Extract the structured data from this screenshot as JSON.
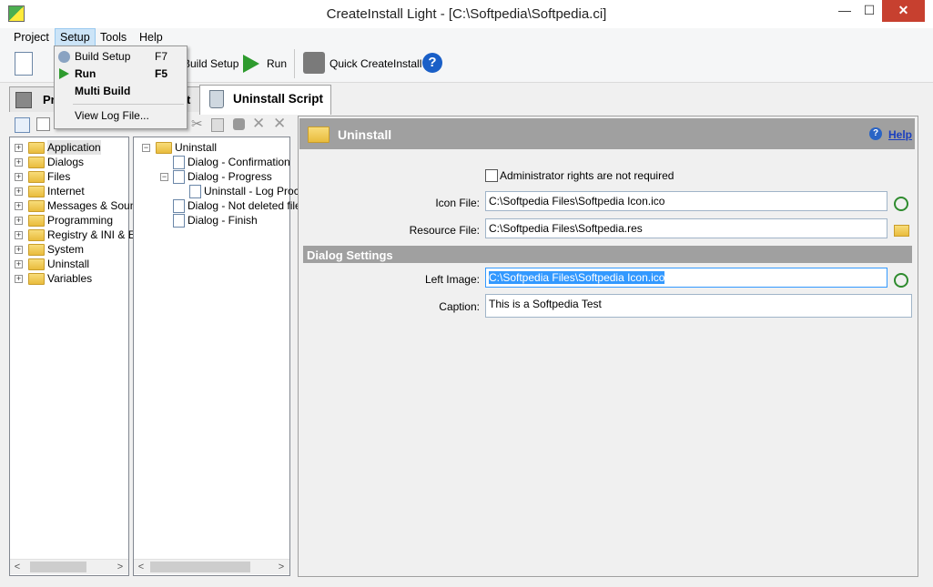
{
  "window": {
    "title": "CreateInstall Light - [C:\\Softpedia\\Softpedia.ci]",
    "min": "—",
    "max": "☐",
    "close": "✕"
  },
  "menu": [
    "Project",
    "Setup",
    "Tools",
    "Help"
  ],
  "toolbar": {
    "build_label": "Build Setup",
    "run_label": "Run",
    "quick_label": "Quick CreateInstall",
    "help_glyph": "?"
  },
  "tabs": {
    "project": "Pr",
    "script": "pt",
    "uninstall": "Uninstall Script"
  },
  "setup_menu": [
    {
      "label": "Build Setup",
      "key": "F7"
    },
    {
      "label": "Run",
      "key": "F5"
    },
    {
      "label": "Multi Build",
      "key": ""
    },
    {
      "label": "View Log File...",
      "key": ""
    }
  ],
  "tree_left": [
    "Application",
    "Dialogs",
    "Files",
    "Internet",
    "Messages & Sound",
    "Programming",
    "Registry & INI & En",
    "System",
    "Uninstall",
    "Variables"
  ],
  "tree_mid": [
    "Uninstall",
    "Dialog - Confirmation",
    "Dialog - Progress",
    "Uninstall - Log Proc",
    "Dialog - Not deleted file",
    "Dialog - Finish"
  ],
  "panel": {
    "header": "Uninstall",
    "help_link": "Help",
    "admin_checkbox": "Administrator rights are not required",
    "icon_file_label": "Icon File:",
    "icon_file_value": "C:\\Softpedia Files\\Softpedia Icon.ico",
    "resource_file_label": "Resource File:",
    "resource_file_value": "C:\\Softpedia Files\\Softpedia.res",
    "dialog_settings": "Dialog Settings",
    "left_image_label": "Left Image:",
    "left_image_value": "C:\\Softpedia Files\\Softpedia Icon.ico",
    "caption_label": "Caption:",
    "caption_value": "This is a Softpedia Test"
  },
  "colors": {
    "accent": "#3399ff",
    "header_gray": "#a0a0a0",
    "close_red": "#c7402f"
  }
}
